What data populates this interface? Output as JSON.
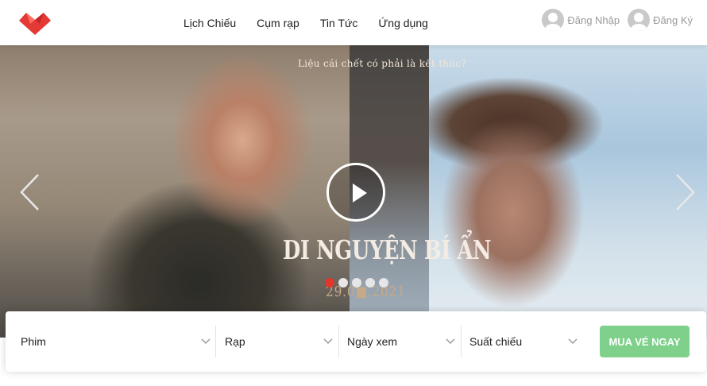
{
  "header": {
    "nav": [
      "Lịch Chiếu",
      "Cụm rạp",
      "Tin Tức",
      "Ứng dụng"
    ],
    "login_label": "Đăng Nhập",
    "register_label": "Đăng Ký",
    "logo_icon": "heart-logo-icon",
    "logo_color": "#e53935"
  },
  "hero": {
    "tagline": "Liệu cái chết có phải là kết thúc?",
    "movie_title": "DI NGUYỆN BÍ ẨN",
    "movie_subtitle": "",
    "release_date": "29.0■.2021",
    "play_icon": "play-icon",
    "prev_icon": "chevron-left-icon",
    "next_icon": "chevron-right-icon",
    "slide_count": 5,
    "active_slide": 1
  },
  "booking": {
    "fields": [
      "Phim",
      "Rạp",
      "Ngày xem",
      "Suất chiếu"
    ],
    "buy_label": "MUA VÉ NGAY",
    "buy_color": "#7ed08a",
    "dropdown_icon": "chevron-down-icon"
  }
}
